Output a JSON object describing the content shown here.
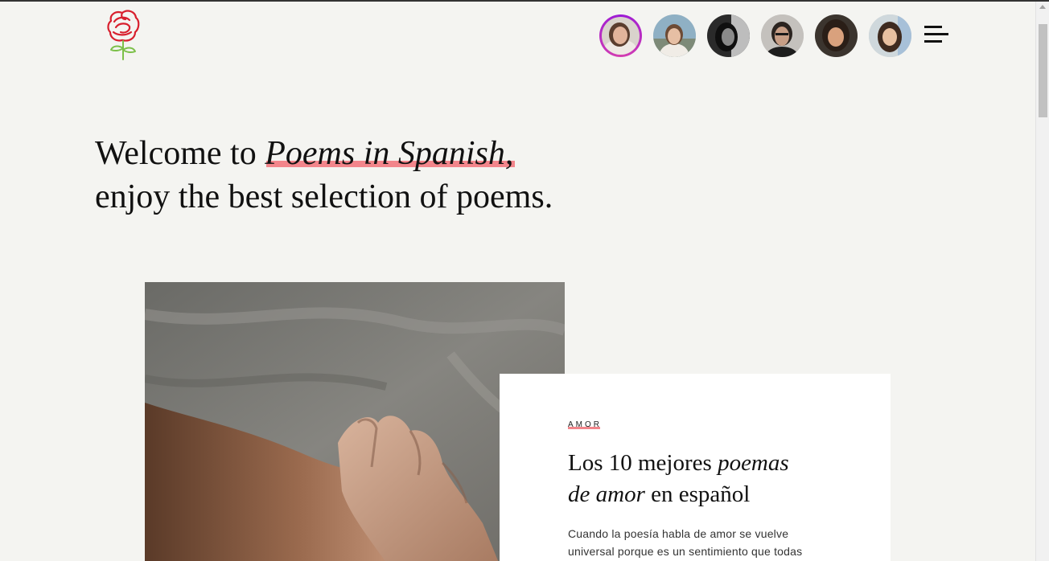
{
  "header": {
    "logo_icon": "rose-icon",
    "avatars": [
      {
        "name": "avatar-1",
        "active": true
      },
      {
        "name": "avatar-2",
        "active": false
      },
      {
        "name": "avatar-3",
        "active": false
      },
      {
        "name": "avatar-4",
        "active": false
      },
      {
        "name": "avatar-5",
        "active": false
      },
      {
        "name": "avatar-6",
        "active": false
      }
    ],
    "menu_icon": "hamburger-menu-icon"
  },
  "hero": {
    "prefix": "Welcome to",
    "site_name": "Poems in Spanish",
    "comma": ",",
    "line2": "enjoy the best selection of poems."
  },
  "featured": {
    "category": "AMOR",
    "title_part1": "Los 10 mejores ",
    "title_italic1": "poemas",
    "title_italic2": "de amor",
    "title_part2": " en español",
    "excerpt": "Cuando la poesía habla de amor se vuelve universal porque es un sentimiento que todas"
  },
  "colors": {
    "background": "#f4f4f1",
    "highlight": "#f2858b",
    "active_ring": "#9b1ad6"
  }
}
